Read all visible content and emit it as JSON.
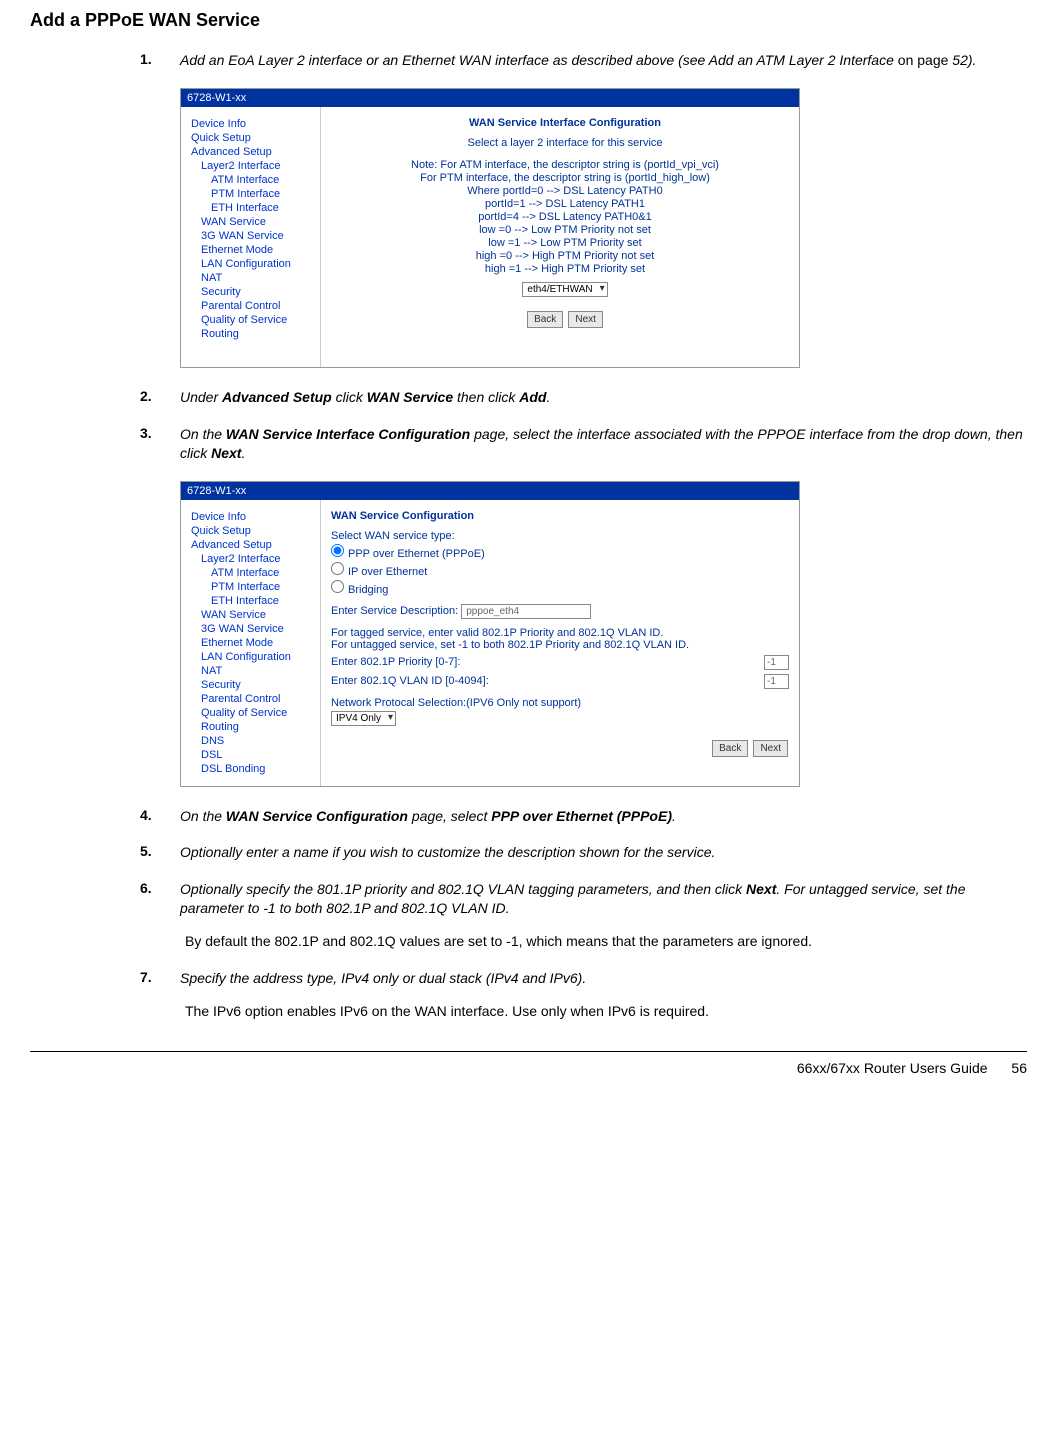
{
  "heading": "Add a PPPoE WAN Service",
  "steps": {
    "s1": {
      "num": "1.",
      "text_a": "Add an EoA Layer 2 interface or an Ethernet WAN interface as described above (see Add an ATM Layer 2 Interface ",
      "text_b": "on page",
      "text_c": " 52)."
    },
    "s2": {
      "num": "2.",
      "text_a": "Under ",
      "b1": "Advanced Setup",
      "text_b": " click ",
      "b2": "WAN Service",
      "text_c": " then click ",
      "b3": "Add",
      "text_d": "."
    },
    "s3": {
      "num": "3.",
      "text_a": "On the ",
      "b1": "WAN Service Interface Configuration",
      "text_b": " page, select the interface associated with the PPPOE interface from the drop down, then click ",
      "b2": "Next",
      "text_c": "."
    },
    "s4": {
      "num": "4.",
      "text_a": "On the ",
      "b1": "WAN Service Configuration",
      "text_b": " page, select ",
      "b2": "PPP over Ethernet (PPPoE)",
      "text_c": "."
    },
    "s5": {
      "num": "5.",
      "text": "Optionally enter a name if you wish to customize the description shown for the service."
    },
    "s6": {
      "num": "6.",
      "text_a": "Optionally specify the 801.1P priority and 802.1Q VLAN tagging parameters, and then click ",
      "b1": "Next",
      "text_b": ".  For untagged service, set the parameter to -1 to both 802.1P and 802.1Q VLAN ID.",
      "note": "By default the 802.1P and 802.1Q values are set to -1, which means that the parameters are ignored."
    },
    "s7": {
      "num": "7.",
      "text": "Specify the address type, IPv4 only or dual stack (IPv4 and IPv6).",
      "note": "The IPv6 option enables IPv6 on the WAN interface. Use only when IPv6 is required."
    }
  },
  "sidebar": {
    "device_info": "Device Info",
    "quick_setup": "Quick Setup",
    "advanced_setup": "Advanced Setup",
    "layer2": "Layer2 Interface",
    "atm": "ATM Interface",
    "ptm": "PTM Interface",
    "eth": "ETH Interface",
    "wan_service": "WAN Service",
    "3g": "3G WAN Service",
    "eth_mode": "Ethernet Mode",
    "lan": "LAN Configuration",
    "nat": "NAT",
    "security": "Security",
    "parental": "Parental Control",
    "qos": "Quality of Service",
    "routing": "Routing",
    "dns": "DNS",
    "dsl": "DSL",
    "dsl_bonding": "DSL Bonding"
  },
  "sc1": {
    "titlebar": "6728-W1-xx",
    "title": "WAN Service Interface Configuration",
    "subtitle": "Select a layer 2 interface for this service",
    "lines": {
      "l1": "Note: For ATM interface, the descriptor string is (portId_vpi_vci)",
      "l2": "For PTM interface, the descriptor string is (portId_high_low)",
      "l3": "Where portId=0 --> DSL Latency PATH0",
      "l4": "portId=1 --> DSL Latency PATH1",
      "l5": "portId=4 --> DSL Latency PATH0&1",
      "l6": "low =0 --> Low PTM Priority not set",
      "l7": "low =1 --> Low PTM Priority set",
      "l8": "high =0 --> High PTM Priority not set",
      "l9": "high =1 --> High PTM Priority set"
    },
    "select": "eth4/ETHWAN",
    "back": "Back",
    "next": "Next"
  },
  "sc2": {
    "titlebar": "6728-W1-xx",
    "title": "WAN Service Configuration",
    "select_type": "Select WAN service type:",
    "r1": "PPP over Ethernet (PPPoE)",
    "r2": "IP over Ethernet",
    "r3": "Bridging",
    "desc_label": "Enter Service Description:",
    "desc_value": "pppoe_eth4",
    "tag1": "For tagged service, enter valid 802.1P Priority and 802.1Q VLAN ID.",
    "tag2": "For untagged service, set -1 to both 802.1P Priority and 802.1Q VLAN ID.",
    "prio_label": "Enter 802.1P Priority [0-7]:",
    "prio_value": "-1",
    "vlan_label": "Enter 802.1Q VLAN ID [0-4094]:",
    "vlan_value": "-1",
    "proto_label": "Network Protocal Selection:(IPV6 Only not support)",
    "proto_value": "IPV4 Only",
    "back": "Back",
    "next": "Next"
  },
  "footer": {
    "title": "66xx/67xx Router Users Guide",
    "page": "56"
  }
}
